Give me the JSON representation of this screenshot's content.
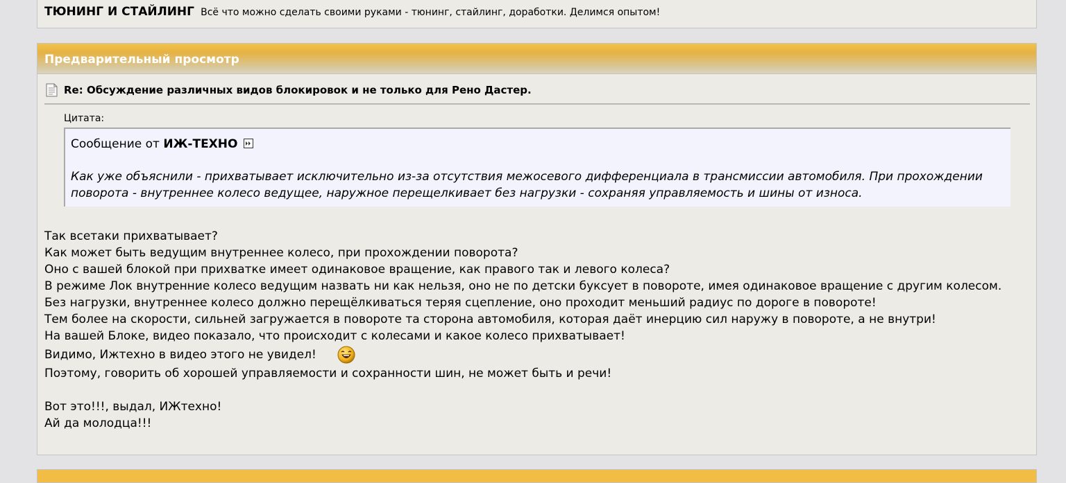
{
  "forum": {
    "title": "ТЮНИНГ И СТАЙЛИНГ",
    "description": "Всё что можно сделать своими руками - тюнинг, стайлинг, доработки. Делимся опытом!"
  },
  "preview": {
    "header": "Предварительный просмотр",
    "post_title": "Re: Обсуждение различных видов блокировок и не только для Рено Дастер.",
    "quote": {
      "label": "Цитата:",
      "from_prefix": "Сообщение от",
      "author": "ИЖ-ТЕХНО",
      "text": "Как уже объяснили - прихватывает исключительно из-за отсутствия межосевого дифференциала в трансмиссии автомобиля. При прохождении поворота - внутреннее колесо ведущее, наружное перещелкивает без нагрузки - сохраняя управляемость и шины от износа."
    },
    "message_lines": [
      "Так всетаки прихватывает?",
      "Как может быть ведущим внутреннее колесо, при прохождении поворота?",
      "Оно с вашей блокой при прихватке имеет одинаковое вращение, как правого так и левого колеса?",
      "В режиме Лок внутренние колесо ведущим назвать ни как нельзя, оно не по детски буксует в повороте, имея одинаковое вращение с другим колесом.",
      "Без нагрузки, внутреннее колесо должно перещёлкиваться теряя сцепление, оно проходит меньший радиус по дороге в повороте!",
      "Тем более на скорости, сильней загружается в повороте та сторона автомобиля, которая даёт инерцию сил наружу в повороте, а не внутри!",
      "На вашей Блоке, видео показало, что происходит с колесами и какое колесо прихватывает!"
    ],
    "smiley_line": "Видимо, Ижтехно в видео этого не увидел!",
    "line_after_smiley": "Поэтому, говорить об хорошей управляемости и сохранности шин, не может быть и речи!",
    "closing_lines": [
      "Вот это!!!, выдал, ИЖтехно!",
      "Ай да молодца!!!"
    ]
  },
  "colors": {
    "page_bg": "#e3e3e5",
    "panel_bg": "#ecebe6",
    "header_gold": "#f3c24a",
    "quote_bg": "#f3f3fd"
  }
}
